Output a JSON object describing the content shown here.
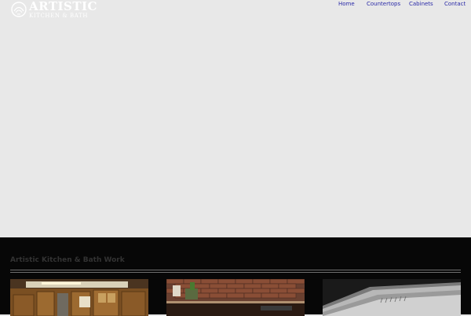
{
  "header": {
    "logo": {
      "line1": "ARTISTIC",
      "line2": "KITCHEN & BATH"
    },
    "nav": [
      {
        "label": "Home"
      },
      {
        "label": "Countertops"
      },
      {
        "label": "Cabinets"
      },
      {
        "label": "Contact"
      }
    ],
    "nav_color": "#2a2aa8"
  },
  "work": {
    "title": "Artistic Kitchen & Bath Work",
    "thumbnails": [
      {
        "name": "kitchen-cabinets-photo"
      },
      {
        "name": "brick-wall-counter-photo"
      },
      {
        "name": "crown-molding-photo"
      }
    ]
  },
  "colors": {
    "page_bg": "#e8e8e8",
    "section_bg": "#070707",
    "title_text": "#333333"
  }
}
